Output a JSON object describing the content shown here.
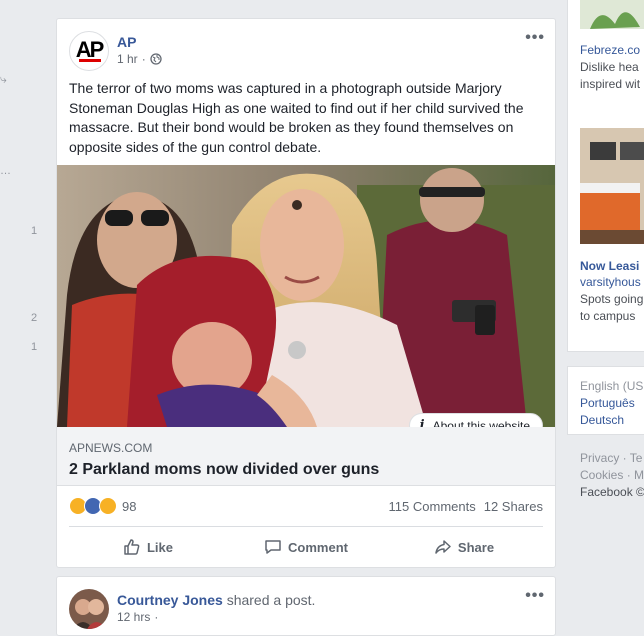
{
  "left_sidebar": {
    "fragments": [
      "…",
      "1",
      "2",
      "1"
    ]
  },
  "post": {
    "author": "AP",
    "time": "1 hr",
    "more_label": "•••",
    "text": "The terror of two moms was captured in a photograph outside Marjory Stoneman Douglas High as one waited to find out if her child survived the massacre. But their bond would be broken as they found themselves on opposite sides of the gun control debate.",
    "about_website": "About this website",
    "link": {
      "domain": "APNEWS.COM",
      "title": "2 Parkland moms now divided over guns"
    },
    "reaction_count": "98",
    "comments": "115 Comments",
    "shares": "12 Shares",
    "actions": {
      "like": "Like",
      "comment": "Comment",
      "share": "Share"
    }
  },
  "next_post": {
    "author": "Courtney Jones",
    "action_text": " shared a post.",
    "time": "12 hrs",
    "more_label": "•••"
  },
  "right_column": {
    "ad1": {
      "sponsor": "Febreze.co",
      "line1": "Dislike hea",
      "line2": "inspired wit"
    },
    "ad2": {
      "title": "Now Leasi",
      "sponsor": "varsityhous",
      "line1": "Spots going",
      "line2": "to campus"
    },
    "languages": [
      "English (US",
      "Português",
      "Deutsch"
    ],
    "footer": {
      "line1": "Privacy · Te",
      "line2": "Cookies · M",
      "line3": "Facebook ©"
    }
  },
  "colors": {
    "link_blue": "#385898",
    "background": "#e9ebee",
    "ap_red": "#dd0000"
  }
}
